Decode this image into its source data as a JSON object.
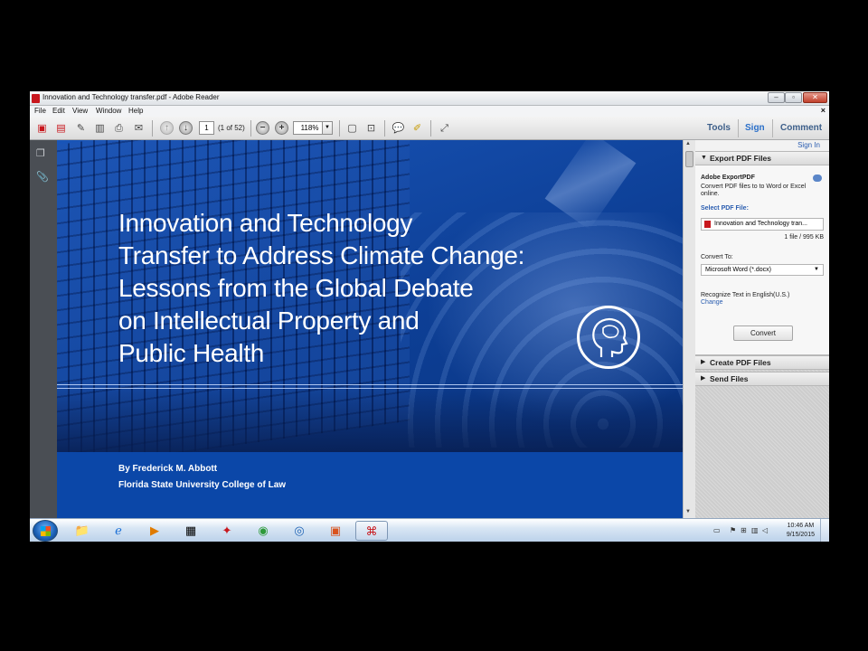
{
  "window": {
    "title": "Innovation and Technology transfer.pdf - Adobe Reader"
  },
  "menu": [
    "File",
    "Edit",
    "View",
    "Window",
    "Help"
  ],
  "toolbar": {
    "page_number": "1",
    "page_count": "(1 of 52)",
    "zoom": "118%",
    "tabs": {
      "tools": "Tools",
      "sign": "Sign",
      "comment": "Comment"
    }
  },
  "document": {
    "title_lines": [
      "Innovation and Technology",
      "Transfer to Address Climate Change:",
      "Lessons from the Global Debate",
      "on Intellectual Property and",
      "Public Health"
    ],
    "author": "By Frederick M. Abbott",
    "affiliation": "Florida State University College of Law"
  },
  "right_pane": {
    "sign_in": "Sign In",
    "export_header": "Export PDF Files",
    "service_name": "Adobe ExportPDF",
    "service_desc_1": "Convert PDF files to to Word or Excel",
    "service_desc_2": "online.",
    "select_label": "Select PDF File:",
    "file_name": "Innovation and Technology tran...",
    "file_info": "1 file / 995 KB",
    "convert_to_label": "Convert To:",
    "convert_to_value": "Microsoft Word (*.docx)",
    "recognize_text": "Recognize Text in English(U.S.)",
    "change_link": "Change",
    "convert_button": "Convert",
    "create_header": "Create PDF Files",
    "send_header": "Send Files"
  },
  "taskbar": {
    "time": "10:46 AM",
    "date": "9/15/2015"
  },
  "colors": {
    "cover_blue": "#0b47a8",
    "tab_text": "#3d5f8a",
    "link_blue": "#2a5db0"
  }
}
